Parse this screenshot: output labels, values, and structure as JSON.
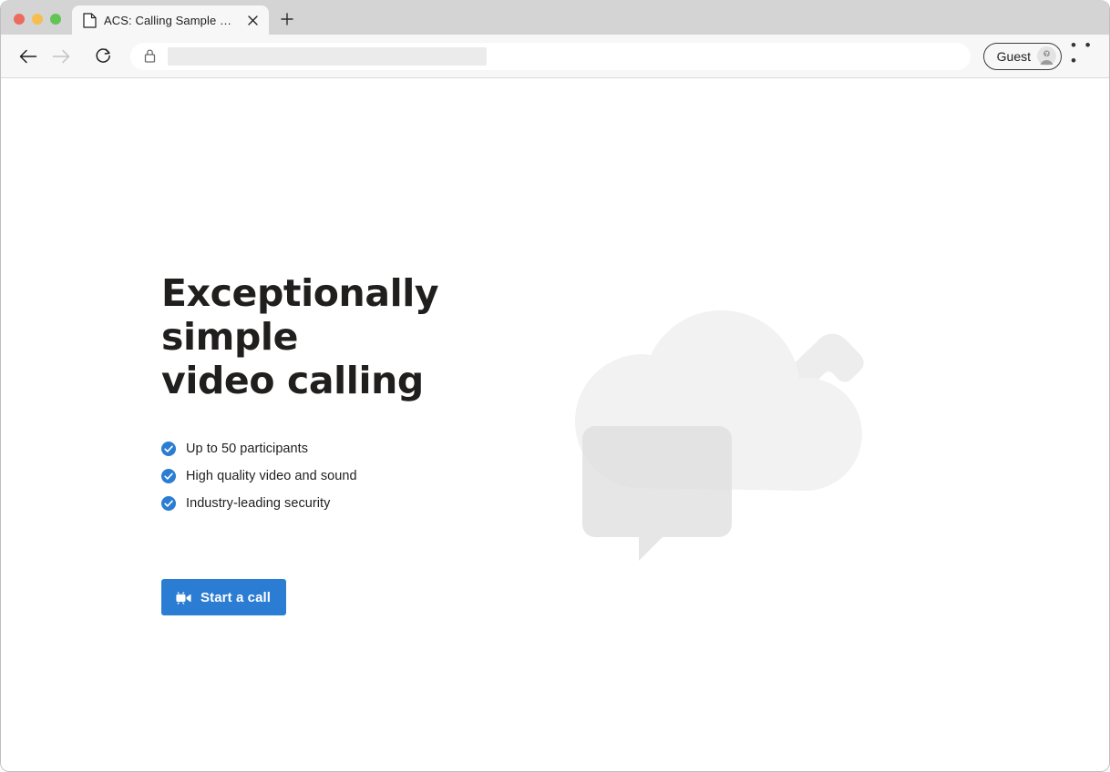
{
  "browser": {
    "window_controls": [
      {
        "name": "close",
        "color": "#ed6a5f"
      },
      {
        "name": "minimize",
        "color": "#f4bf50"
      },
      {
        "name": "maximize",
        "color": "#61c555"
      }
    ],
    "tab": {
      "title": "ACS: Calling Sample app",
      "favicon": "page-icon",
      "close_icon": "close-icon"
    },
    "new_tab_icon": "plus-icon",
    "toolbar": {
      "back_icon": "back-arrow-icon",
      "forward_icon": "forward-arrow-icon",
      "forward_disabled": true,
      "reload_icon": "reload-icon",
      "address": {
        "lock_icon": "lock-icon",
        "value": "",
        "placeholder": "",
        "redacted": true
      },
      "profile": {
        "label": "Guest",
        "avatar_icon": "guest-avatar-icon"
      },
      "more_icon": "ellipsis-icon",
      "more_label": "• • •"
    }
  },
  "page": {
    "hero": {
      "title_line_1": "Exceptionally simple",
      "title_line_2": "video calling",
      "features": [
        {
          "icon": "check-circle-icon",
          "text": "Up to 50 participants"
        },
        {
          "icon": "check-circle-icon",
          "text": "High quality video and sound"
        },
        {
          "icon": "check-circle-icon",
          "text": "Industry-leading security"
        }
      ],
      "cta": {
        "label": "Start a call",
        "icon": "video-camera-icon",
        "color": "#2b7cd3"
      }
    },
    "illustration": {
      "name": "cloud-chat-phone-illustration",
      "cloud_color": "#f2f2f2",
      "bubble_color": "#e6e6e6",
      "phone_color": "#eeeeee"
    }
  },
  "colors": {
    "accent": "#2b7cd3",
    "text": "#201f1e",
    "chrome_bg": "#f7f7f7",
    "titlebar_bg": "#d4d4d4"
  }
}
